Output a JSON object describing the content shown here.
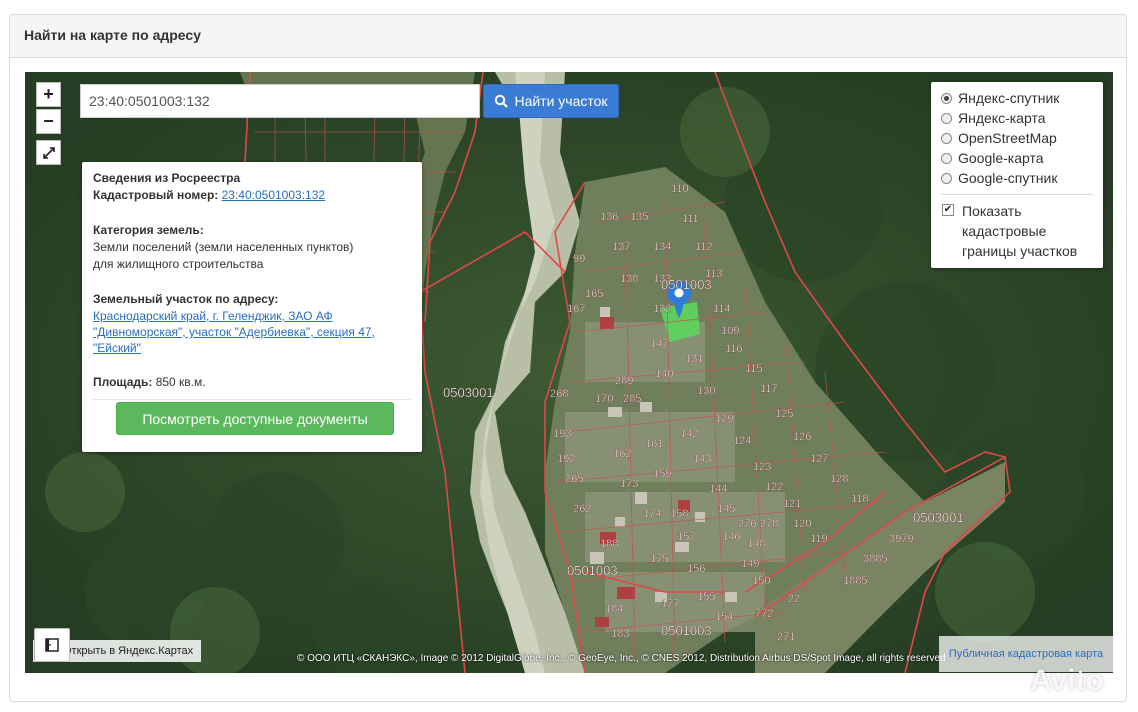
{
  "panel": {
    "title": "Найти на карте по адресу"
  },
  "search": {
    "value": "23:40:0501003:132",
    "button_label": "Найти участок"
  },
  "zoom": {
    "in_label": "+",
    "out_label": "−"
  },
  "info": {
    "header": "Сведения из Росреестра",
    "cadastral_label": "Кадастровый номер:",
    "cadastral_value": "23:40:0501003:132",
    "category_label": "Категория земель:",
    "category_line1": "Земли поселений (земли населенных пунктов)",
    "category_line2": "для жилищного строительства",
    "address_label": "Земельный участок по адресу:",
    "address_line1": "Краснодарский край, г. Геленджик, ЗАО АФ",
    "address_line2": "\"Дивноморская\", участок \"Адербиевка\", секция 47,",
    "address_line3": "\"Ейский\"",
    "area_label": "Площадь:",
    "area_value": "850 кв.м.",
    "docs_button": "Посмотреть доступные документы"
  },
  "layers": {
    "options": [
      {
        "label": "Яндекс-спутник",
        "selected": true
      },
      {
        "label": "Яндекс-карта",
        "selected": false
      },
      {
        "label": "OpenStreetMap",
        "selected": false
      },
      {
        "label": "Google-карта",
        "selected": false
      },
      {
        "label": "Google-спутник",
        "selected": false
      }
    ],
    "show_boundaries_line1": "Показать",
    "show_boundaries_line2": "кадастровые",
    "show_boundaries_line3": "границы участков",
    "show_boundaries_checked": true
  },
  "map": {
    "open_yandex": "Открыть в Яндекс.Картах",
    "copyright": "© ООО ИТЦ «СКАНЭКС», Image © 2012 DigitalGlobe, Inc., © GeoEye, Inc., © CNES 2012, Distribution Airbus DS/Spot Image, all rights reserved",
    "pkk_link": "Публичная кадастровая карта",
    "quarters": [
      "0503001",
      "0501003",
      "0501003",
      "0503001",
      "0501003"
    ],
    "plots": [
      "110",
      "136",
      "135",
      "111",
      "137",
      "134",
      "112",
      "113",
      "99",
      "138",
      "133",
      "114",
      "167",
      "165",
      "109",
      "132",
      "147",
      "116",
      "115",
      "131",
      "140",
      "268",
      "170",
      "289",
      "285",
      "130",
      "117",
      "129",
      "125",
      "193",
      "142",
      "124",
      "126",
      "192",
      "162",
      "161",
      "143",
      "123",
      "127",
      "265",
      "173",
      "159",
      "122",
      "128",
      "144",
      "121",
      "118",
      "262",
      "174",
      "145",
      "276",
      "120",
      "158",
      "278",
      "119",
      "188",
      "157",
      "148",
      "175",
      "146",
      "149",
      "156",
      "150",
      "184",
      "177",
      "155",
      "154",
      "183",
      "22",
      "772",
      "271",
      "3979",
      "3885",
      "1885"
    ],
    "watermark": "Avito"
  }
}
